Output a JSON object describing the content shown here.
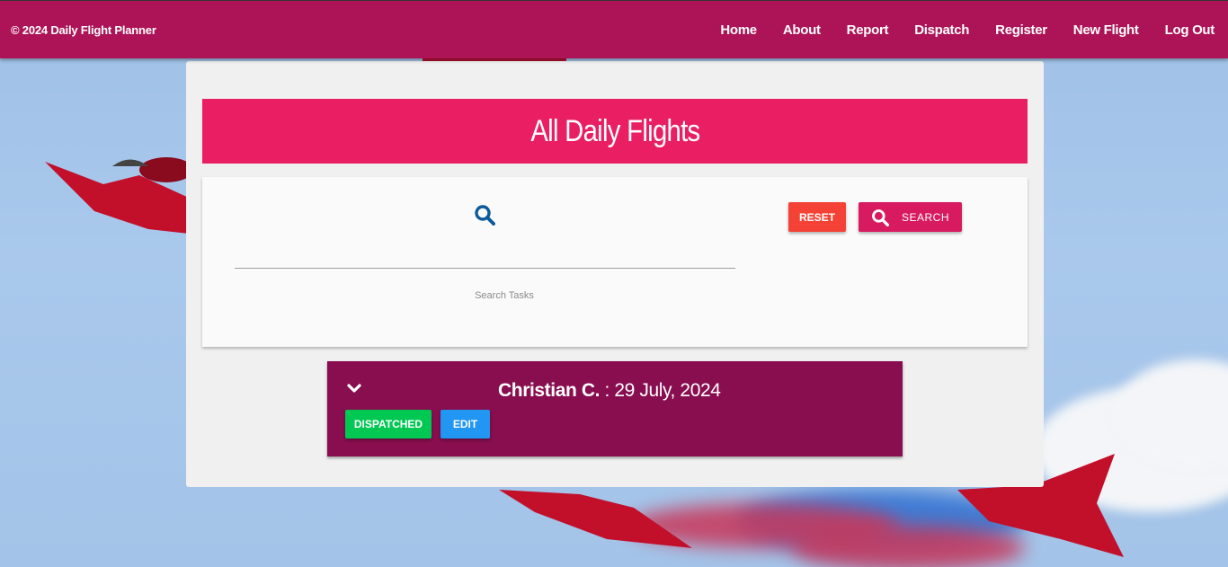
{
  "navbar": {
    "brand": "© 2024 Daily Flight Planner",
    "items": [
      "Home",
      "About",
      "Report",
      "Dispatch",
      "Register",
      "New Flight",
      "Log Out"
    ]
  },
  "page": {
    "title": "All Daily Flights"
  },
  "search": {
    "value": "",
    "label": "Search Tasks",
    "reset_label": "RESET",
    "search_label": "SEARCH",
    "icon": "search-icon"
  },
  "flights": [
    {
      "name": "Christian C.",
      "separator": " : ",
      "date": "29 July, 2024",
      "status_label": "DISPATCHED",
      "edit_label": "EDIT",
      "expand_icon": "chevron-down-icon"
    }
  ],
  "colors": {
    "navbar": "#ad1457",
    "title_bar": "#e91e63",
    "flight_card": "#880e4f",
    "reset": "#f44336",
    "search": "#d81b60",
    "dispatched": "#00c853",
    "edit": "#2196f3",
    "search_icon": "#0d5a9a"
  }
}
